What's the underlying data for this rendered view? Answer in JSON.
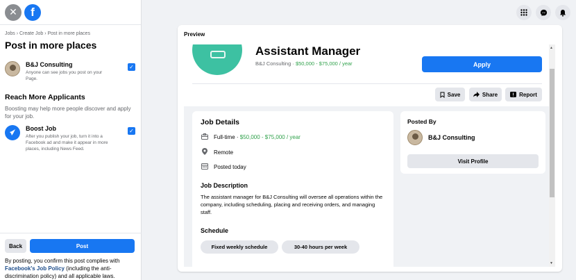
{
  "sidebar": {
    "close_icon": "✕",
    "logo_letter": "f",
    "breadcrumb": "Jobs › Create Job › Post in more places",
    "title": "Post in more places",
    "account": {
      "name": "B&J Consulting",
      "desc": "Anyone can see jobs you post on your Page.",
      "checked": true
    },
    "reach_title": "Reach More Applicants",
    "reach_desc": "Boosting may help more people discover and apply for your job.",
    "boost": {
      "name": "Boost Job",
      "desc": "After you publish your job, turn it into a Facebook ad and make it appear in more places, including News Feed.",
      "checked": true
    },
    "back_label": "Back",
    "post_label": "Post",
    "policy_prefix": "By posting, you confirm this post complies with ",
    "policy_link": "Facebook's Job Policy",
    "policy_suffix": " (including the anti-discrimination policy) and all applicable laws."
  },
  "top_icons": [
    "menu-grid-icon",
    "messenger-icon",
    "notifications-icon"
  ],
  "preview": {
    "label": "Preview",
    "job_title": "Assistant Manager",
    "company": "B&J Consulting · ",
    "salary_header": "$50,000 - $75,000 / year",
    "apply_label": "Apply",
    "save_label": "Save",
    "share_label": "Share",
    "report_label": "Report",
    "details_title": "Job Details",
    "job_type": "Full-time · ",
    "salary": "$50,000 - $75,000 / year",
    "location": "Remote",
    "posted": "Posted today",
    "desc_title": "Job Description",
    "desc_text": "The assistant manager for B&J Consulting will oversee all operations within the company, including scheduling, placing and receiving orders, and managing staff.",
    "schedule_title": "Schedule",
    "schedule_chips": [
      "Fixed weekly schedule",
      "30-40 hours per week"
    ],
    "posted_by_title": "Posted By",
    "posted_by_name": "B&J Consulting",
    "visit_label": "Visit Profile"
  },
  "colors": {
    "brand": "#1877f2",
    "logo": "#3dc1a2",
    "green": "#31a24c"
  }
}
